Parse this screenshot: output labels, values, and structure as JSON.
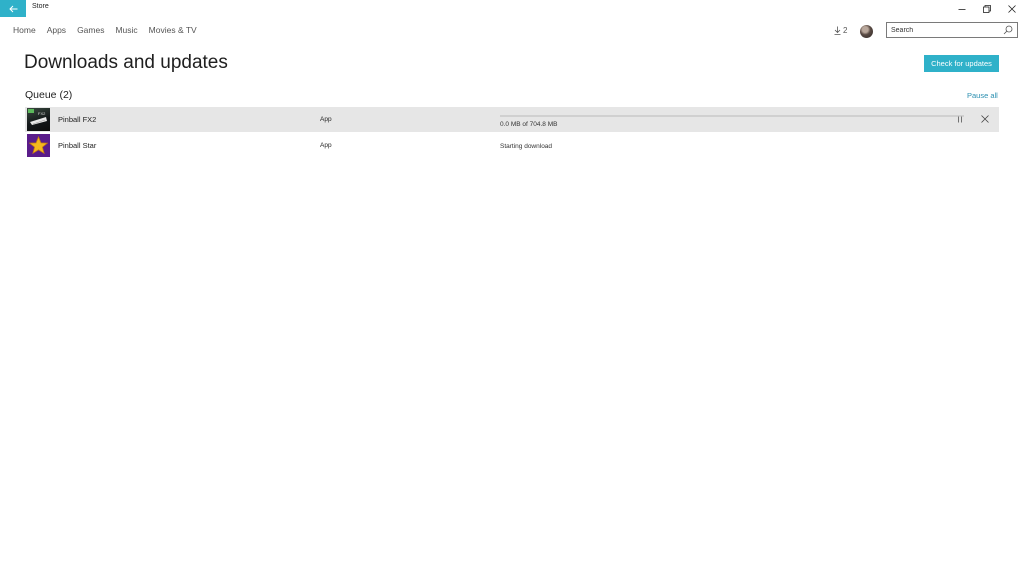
{
  "window": {
    "title": "Store"
  },
  "nav": {
    "items": [
      {
        "label": "Home"
      },
      {
        "label": "Apps"
      },
      {
        "label": "Games"
      },
      {
        "label": "Music"
      },
      {
        "label": "Movies & TV"
      }
    ]
  },
  "header": {
    "downloads_count": "2",
    "search_placeholder": "Search"
  },
  "page": {
    "title": "Downloads and updates",
    "check_button": "Check for updates",
    "queue_heading": "Queue (2)",
    "pause_all": "Pause all"
  },
  "queue": [
    {
      "name": "Pinball FX2",
      "kind": "App",
      "status": "0.0 MB of 704.8 MB",
      "progress": 0.0,
      "icon": "pinball-fx2-thumbnail"
    },
    {
      "name": "Pinball Star",
      "kind": "App",
      "status": "Starting download",
      "icon": "pinball-star-thumbnail"
    }
  ],
  "colors": {
    "accent": "#2fb1c9",
    "row_highlight": "#e6e6e6",
    "link": "#2a8fb0"
  },
  "icons": [
    "back-arrow-icon",
    "minimize-icon",
    "restore-icon",
    "close-icon",
    "download-icon",
    "search-icon",
    "pause-icon",
    "cancel-icon"
  ]
}
